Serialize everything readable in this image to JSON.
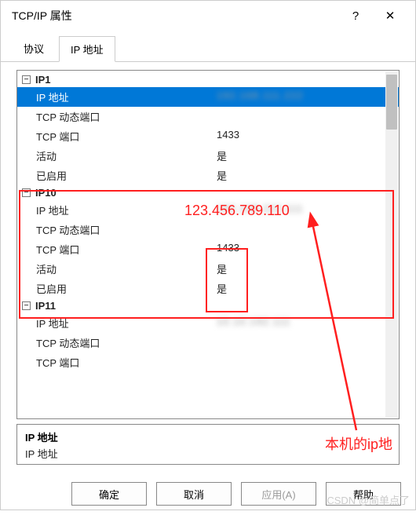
{
  "dialog": {
    "title": "TCP/IP 属性",
    "help_glyph": "?",
    "close_glyph": "✕"
  },
  "tabs": {
    "protocol": "协议",
    "ip_addresses": "IP 地址"
  },
  "groups": {
    "ip1": {
      "name": "IP1",
      "rows": {
        "ip_address_label": "IP 地址",
        "ip_address_value": "192.168.111.222",
        "tcp_dyn_port_label": "TCP 动态端口",
        "tcp_dyn_port_value": "",
        "tcp_port_label": "TCP 端口",
        "tcp_port_value": "1433",
        "active_label": "活动",
        "active_value": "是",
        "enabled_label": "已启用",
        "enabled_value": "是"
      }
    },
    "ip10": {
      "name": "IP10",
      "rows": {
        "ip_address_label": "IP 地址",
        "ip_address_value": "192.168.222.111",
        "tcp_dyn_port_label": "TCP 动态端口",
        "tcp_dyn_port_value": "",
        "tcp_port_label": "TCP 端口",
        "tcp_port_value": "1433",
        "active_label": "活动",
        "active_value": "是",
        "enabled_label": "已启用",
        "enabled_value": "是"
      }
    },
    "ip11": {
      "name": "IP11",
      "rows": {
        "ip_address_label": "IP 地址",
        "ip_address_value": "10.10.192.111",
        "tcp_dyn_port_label": "TCP 动态端口",
        "tcp_dyn_port_value": "",
        "tcp_port_label": "TCP 端口",
        "tcp_port_value": ""
      }
    }
  },
  "desc": {
    "heading": "IP 地址",
    "sub": "IP 地址"
  },
  "buttons": {
    "ok": "确定",
    "cancel": "取消",
    "apply": "应用(A)",
    "help": "帮助"
  },
  "annotations": {
    "sample_ip": "123.456.789.110",
    "local_ip_note": "本机的ip地"
  },
  "watermark": "CSDN @简单点了",
  "toggle_glyph": "−"
}
